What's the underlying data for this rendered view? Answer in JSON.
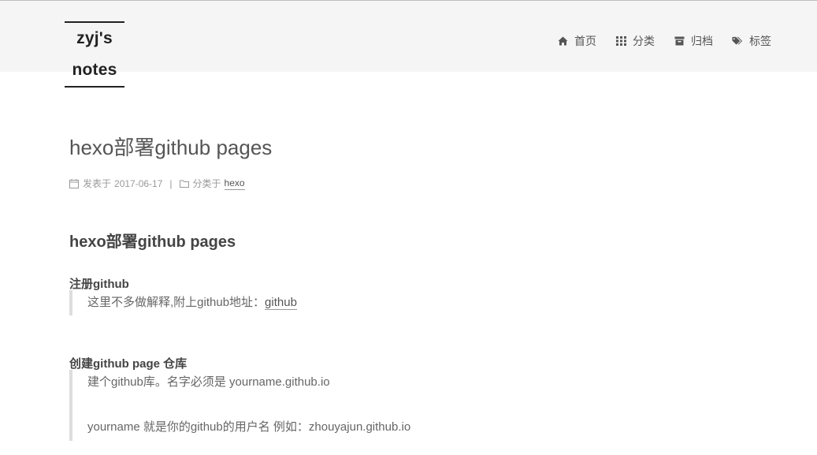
{
  "site": {
    "title": "zyj's notes"
  },
  "nav": [
    {
      "label": "首页",
      "icon": "home-icon"
    },
    {
      "label": "分类",
      "icon": "grid-icon"
    },
    {
      "label": "归档",
      "icon": "archive-icon"
    },
    {
      "label": "标签",
      "icon": "tags-icon"
    }
  ],
  "post": {
    "title": "hexo部署github pages",
    "meta": {
      "posted_prefix": "发表于",
      "date": "2017-06-17",
      "separator": "|",
      "category_prefix": "分类于",
      "category": "hexo"
    },
    "h2": "hexo部署github pages",
    "section1": {
      "heading": "注册github",
      "quote_text": "这里不多做解释,附上github地址：",
      "quote_link": "github"
    },
    "section2": {
      "heading": "创建github page 仓库",
      "quote_line1": "建个github库。名字必须是 yourname.github.io",
      "quote_line2": "yourname 就是你的github的用户名 例如：zhouyajun.github.io"
    }
  },
  "colors": {
    "header_bg": "#f5f5f5",
    "brand_text": "#222222",
    "body_text": "#555555",
    "quote_border": "#dddddd"
  }
}
